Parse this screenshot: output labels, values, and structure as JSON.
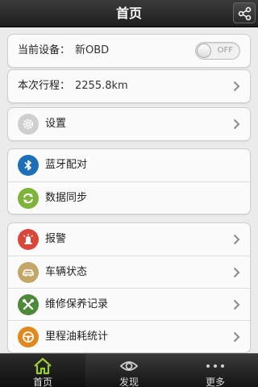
{
  "header": {
    "title": "首页",
    "share_icon": "share-icon"
  },
  "device": {
    "label": "当前设备：",
    "value": "新OBD",
    "toggle": "OFF"
  },
  "trip": {
    "label": "本次行程：",
    "value": "2255.8km"
  },
  "settings": {
    "label": "设置",
    "icon": "gear-icon"
  },
  "connect_group": [
    {
      "label": "蓝牙配对",
      "icon": "bluetooth-icon",
      "color": "#1d6fb8"
    },
    {
      "label": "数据同步",
      "icon": "sync-icon",
      "color": "#7fb43a"
    }
  ],
  "feature_group": [
    {
      "label": "报警",
      "icon": "alarm-icon",
      "color": "#d9463a"
    },
    {
      "label": "车辆状态",
      "icon": "car-icon",
      "color": "#c2a766"
    },
    {
      "label": "维修保养记录",
      "icon": "tools-icon",
      "color": "#4f8a3a"
    },
    {
      "label": "里程油耗统计",
      "icon": "steering-wheel-icon",
      "color": "#e08a1e"
    }
  ],
  "tabs": [
    {
      "label": "首页",
      "icon": "home-icon",
      "active": true
    },
    {
      "label": "发现",
      "icon": "eye-icon",
      "active": false
    },
    {
      "label": "更多",
      "icon": "more-dots-icon",
      "active": false
    }
  ]
}
